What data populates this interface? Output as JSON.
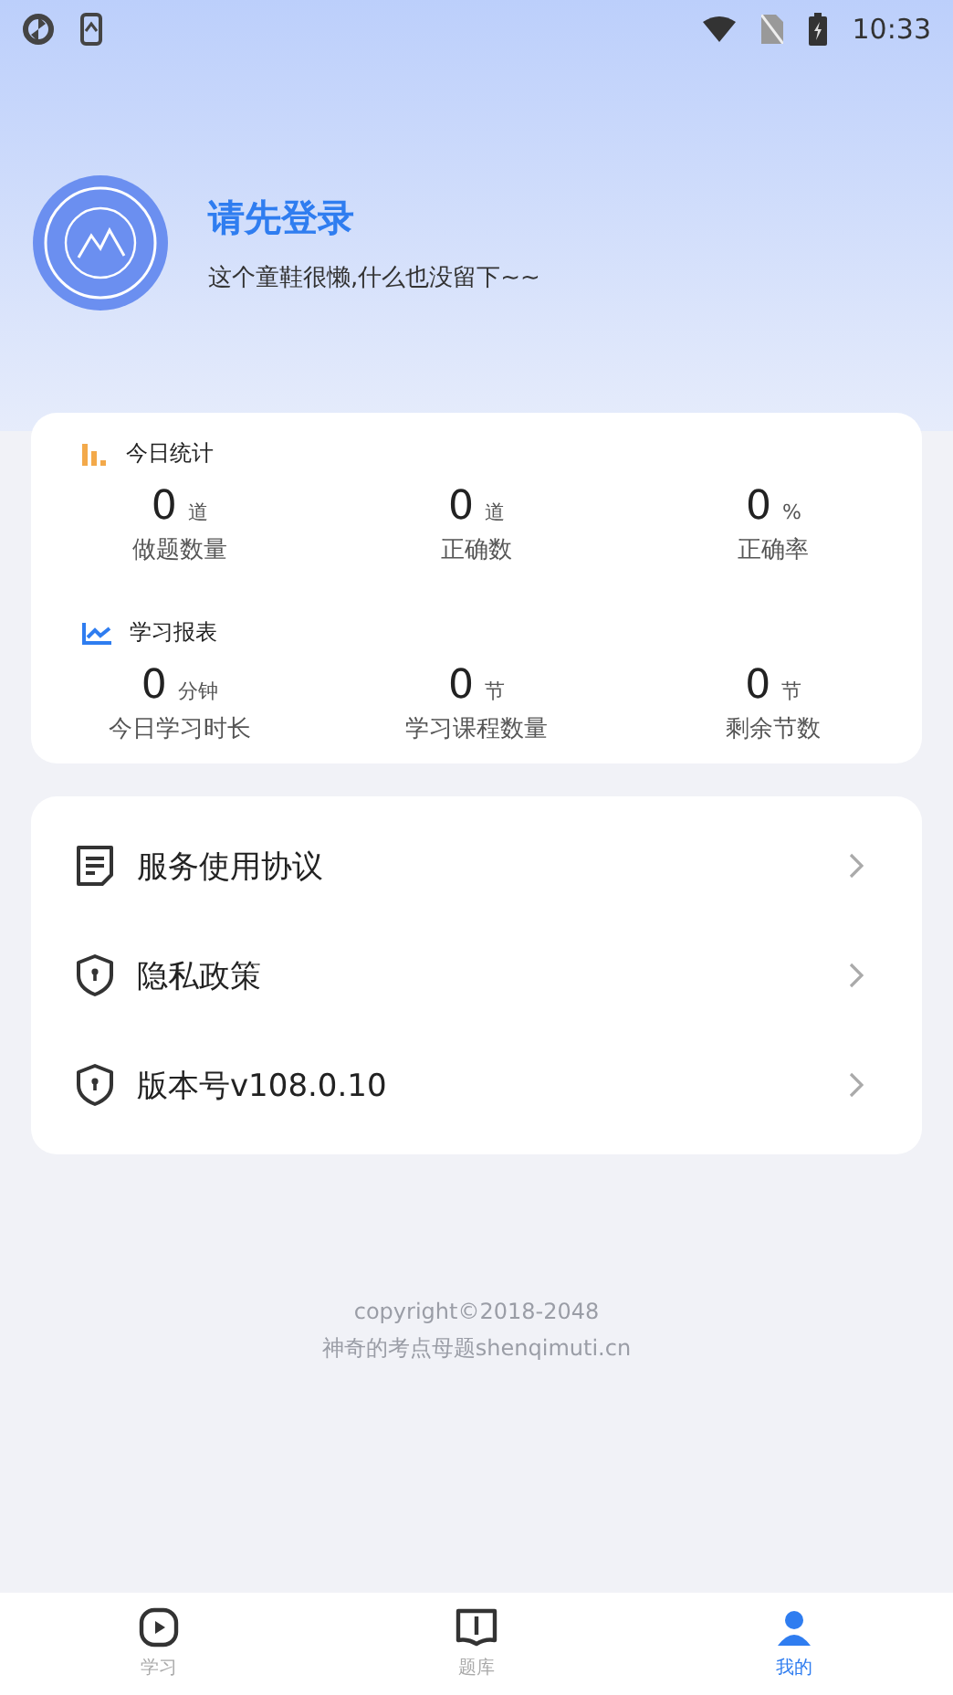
{
  "status_bar": {
    "time": "10:33"
  },
  "profile": {
    "name": "请先登录",
    "bio": "这个童鞋很懒,什么也没留下~~"
  },
  "stat_sections": [
    {
      "title": "今日统计",
      "kind": "bars",
      "stats": [
        {
          "value": "0",
          "unit": "道",
          "label": "做题数量"
        },
        {
          "value": "0",
          "unit": "道",
          "label": "正确数"
        },
        {
          "value": "0",
          "unit": "%",
          "label": "正确率"
        }
      ]
    },
    {
      "title": "学习报表",
      "kind": "line",
      "stats": [
        {
          "value": "0",
          "unit": "分钟",
          "label": "今日学习时长"
        },
        {
          "value": "0",
          "unit": "节",
          "label": "学习课程数量"
        },
        {
          "value": "0",
          "unit": "节",
          "label": "剩余节数"
        }
      ]
    }
  ],
  "menu": [
    {
      "label": "服务使用协议",
      "kind": "document"
    },
    {
      "label": "隐私政策",
      "kind": "shield"
    },
    {
      "label": "版本号v108.0.10",
      "kind": "shield"
    }
  ],
  "footer": [
    "copyright©2018-2048",
    "神奇的考点母题shenqimuti.cn"
  ],
  "tabs": [
    {
      "label": "学习",
      "kind": "play",
      "selected": false
    },
    {
      "label": "题库",
      "kind": "book",
      "selected": false
    },
    {
      "label": "我的",
      "kind": "person",
      "selected": true
    }
  ]
}
